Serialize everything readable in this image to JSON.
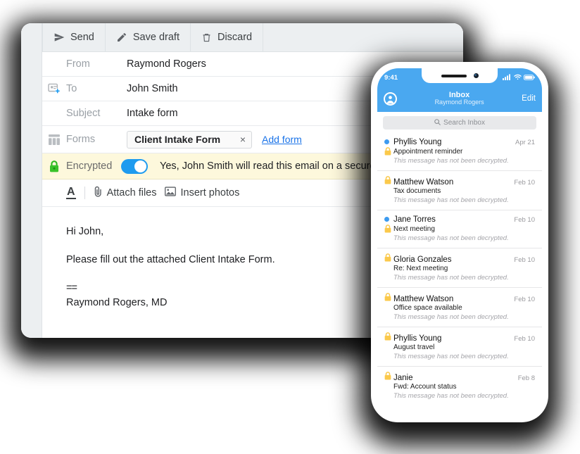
{
  "desktop": {
    "toolbar": {
      "buttons": [
        {
          "label": "Send",
          "icon": "send-icon"
        },
        {
          "label": "Save draft",
          "icon": "pencil-icon"
        },
        {
          "label": "Discard",
          "icon": "trash-icon"
        }
      ]
    },
    "fields": {
      "from": {
        "label": "From",
        "value": "Raymond Rogers"
      },
      "to": {
        "label": "To",
        "value": "John Smith",
        "icon": "add-contact-icon"
      },
      "subject": {
        "label": "Subject",
        "value": "Intake form"
      },
      "forms": {
        "label": "Forms",
        "icon": "form-icon",
        "chip": "Client Intake Form",
        "chip_remove": "×",
        "add_link": "Add form"
      },
      "encrypted": {
        "label": "Encrypted",
        "icon": "lock-icon",
        "toggle_on": true,
        "message": "Yes, John Smith will read this email on a secure web page."
      }
    },
    "format_bar": {
      "text_format": "A",
      "attach_files": "Attach files",
      "attach_icon": "paperclip-icon",
      "insert_photos": "Insert photos",
      "photo_icon": "image-icon"
    },
    "body": {
      "greeting": "Hi John,",
      "paragraph": "Please fill out the attached Client Intake Form.",
      "signature_rule": "==",
      "signature": "Raymond Rogers, MD"
    }
  },
  "phone": {
    "status": {
      "time": "9:41",
      "signal_icon": "cellular-signal-icon",
      "wifi_icon": "wifi-icon",
      "battery_icon": "battery-icon"
    },
    "nav": {
      "avatar_icon": "account-avatar-icon",
      "title": "Inbox",
      "subtitle": "Raymond Rogers",
      "edit_label": "Edit"
    },
    "search": {
      "placeholder": "Search Inbox",
      "icon": "search-icon"
    },
    "messages": [
      {
        "sender": "Phyllis Young",
        "subject": "Appointment reminder",
        "preview": "This message has not been decrypted.",
        "date": "Apr 21",
        "unread": true,
        "lock": true
      },
      {
        "sender": "Matthew Watson",
        "subject": "Tax documents",
        "preview": "This message has not been decrypted.",
        "date": "Feb 10",
        "unread": false,
        "lock": true
      },
      {
        "sender": "Jane Torres",
        "subject": "Next meeting",
        "preview": "This message has not been decrypted.",
        "date": "Feb 10",
        "unread": true,
        "lock": true
      },
      {
        "sender": "Gloria Gonzales",
        "subject": "Re: Next meeting",
        "preview": "This message has not been decrypted.",
        "date": "Feb 10",
        "unread": false,
        "lock": true
      },
      {
        "sender": "Matthew Watson",
        "subject": "Office space available",
        "preview": "This message has not been decrypted.",
        "date": "Feb 10",
        "unread": false,
        "lock": true
      },
      {
        "sender": "Phyllis Young",
        "subject": "August travel",
        "preview": "This message has not been decrypted.",
        "date": "Feb 10",
        "unread": false,
        "lock": true
      },
      {
        "sender": "Janie",
        "subject": "Fwd: Account status",
        "preview": "This message has not been decrypted.",
        "date": "Feb 8",
        "unread": false,
        "lock": true
      }
    ]
  },
  "colors": {
    "accent_blue": "#1e9bef",
    "phone_header_blue": "#4aa8f0",
    "lock_yellow": "#fbc94b",
    "encrypted_green": "#2cba1e",
    "encrypted_row_bg": "#fdf8dc",
    "link_blue": "#1a73e8",
    "unread_dot_blue": "#3d9bf0"
  }
}
